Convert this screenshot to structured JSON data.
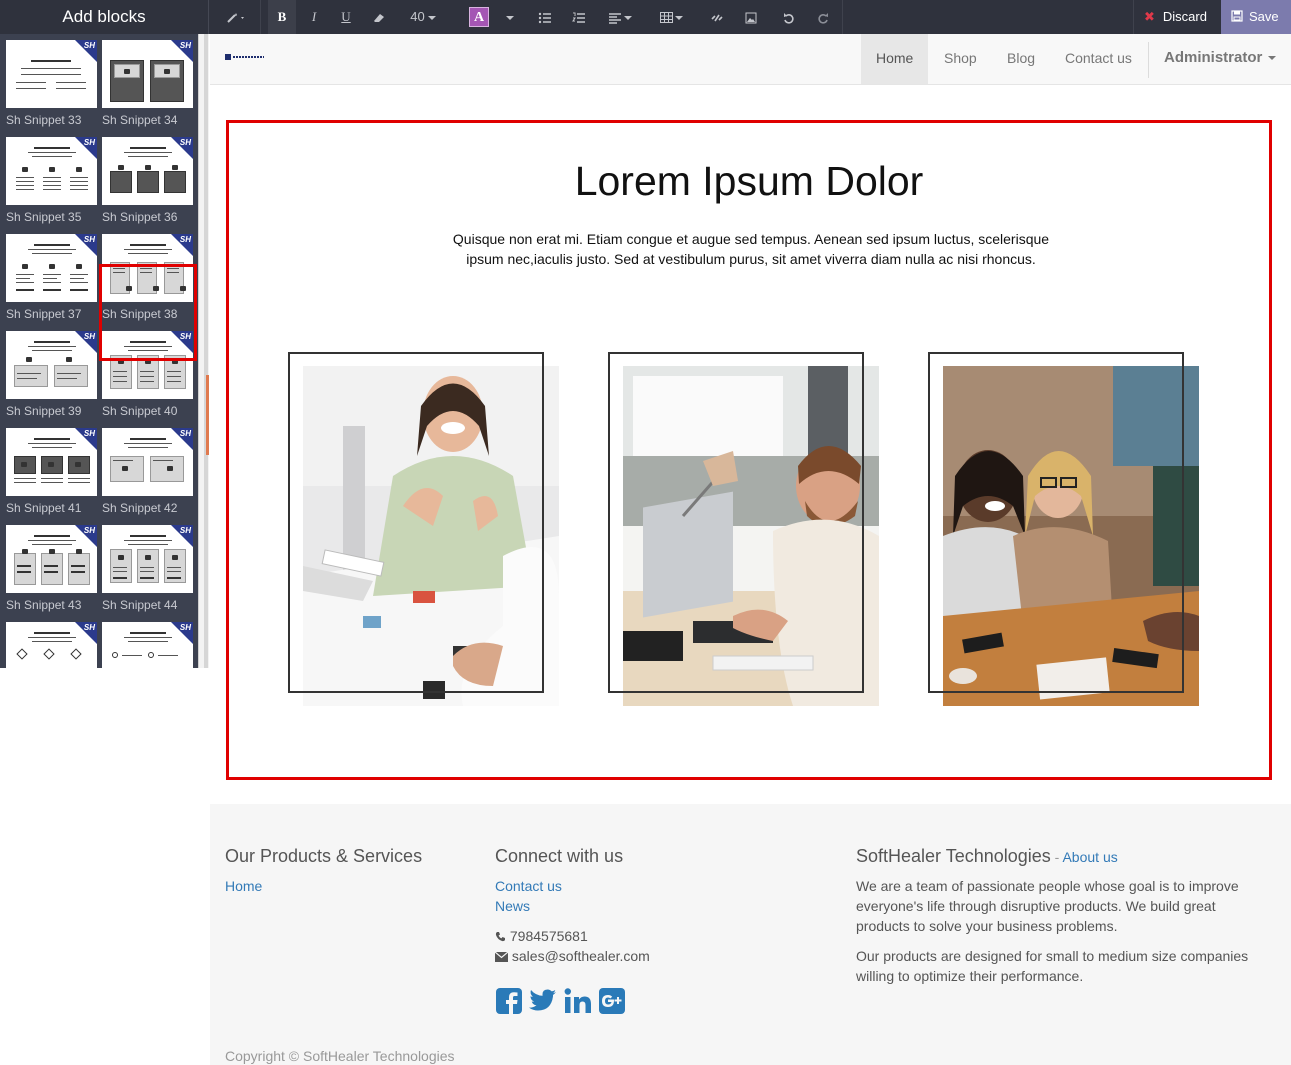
{
  "editor": {
    "panel_title": "Add blocks",
    "font_size": "40",
    "discard_label": "Discard",
    "save_label": "Save",
    "accent": "#7c7bad"
  },
  "sidebar": {
    "snippets": [
      {
        "label": "Sh Snippet 33"
      },
      {
        "label": "Sh Snippet 34"
      },
      {
        "label": "Sh Snippet 35"
      },
      {
        "label": "Sh Snippet 36"
      },
      {
        "label": "Sh Snippet 37"
      },
      {
        "label": "Sh Snippet 38",
        "selected": true
      },
      {
        "label": "Sh Snippet 39"
      },
      {
        "label": "Sh Snippet 40"
      },
      {
        "label": "Sh Snippet 41"
      },
      {
        "label": "Sh Snippet 42"
      },
      {
        "label": "Sh Snippet 43"
      },
      {
        "label": "Sh Snippet 44"
      },
      {
        "label": ""
      },
      {
        "label": ""
      }
    ],
    "badge": "SH"
  },
  "nav": {
    "items": [
      "Home",
      "Shop",
      "Blog",
      "Contact us"
    ],
    "user": "Administrator"
  },
  "hero": {
    "title": "Lorem Ipsum Dolor",
    "text": "Quisque non erat mi. Etiam congue et augue sed tempus. Aenean sed ipsum luctus, scelerisque ipsum nec,iaculis justo. Sed at vestibulum purus, sit amet viverra diam nulla ac nisi rhoncus."
  },
  "footer": {
    "col1": {
      "title": "Our Products & Services",
      "links": [
        "Home"
      ]
    },
    "col2": {
      "title": "Connect with us",
      "links": [
        "Contact us",
        "News"
      ],
      "phone": "7984575681",
      "email": "sales@softhealer.com"
    },
    "col3": {
      "title": "SoftHealer Technologies",
      "sep": " - ",
      "about_link": "About us",
      "p1": "We are a team of passionate people whose goal is to improve everyone's life through disruptive products. We build great products to solve your business problems.",
      "p2": "Our products are designed for small to medium size companies willing to optimize their performance."
    },
    "copyright": "Copyright © SoftHealer Technologies",
    "social_color": "#2a7ab8"
  }
}
